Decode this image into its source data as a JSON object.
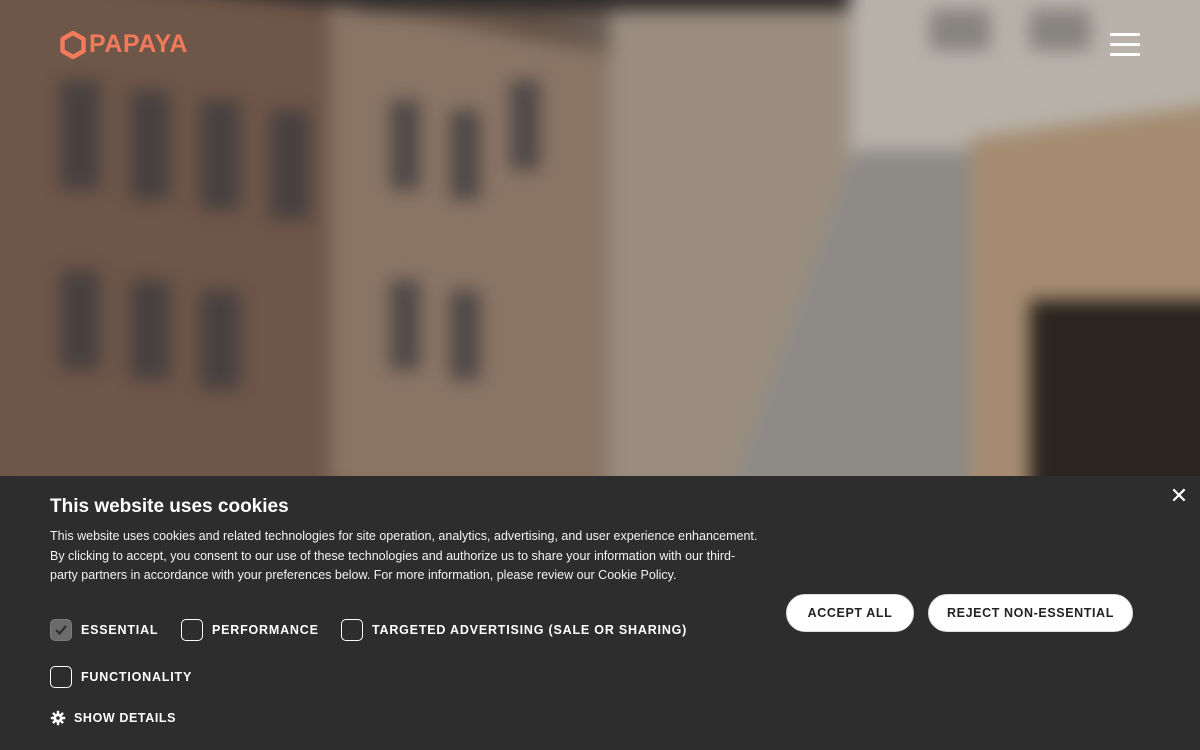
{
  "header": {
    "logo_text": "PAPAYA",
    "logo_color": "#f07a5a",
    "menu_icon": "hamburger-menu-icon"
  },
  "cookie_banner": {
    "title": "This website uses cookies",
    "body": "This website uses cookies and related technologies for site operation, analytics, advertising, and user experience enhancement. By clicking to accept, you consent to our use of these technologies and authorize us to share your information with our third-party partners in accordance with your preferences below. For more information, please review our Cookie Policy.",
    "close_icon": "close-icon",
    "options": [
      {
        "label": "ESSENTIAL",
        "checked": true
      },
      {
        "label": "PERFORMANCE",
        "checked": false
      },
      {
        "label": "TARGETED ADVERTISING (SALE OR SHARING)",
        "checked": false
      },
      {
        "label": "FUNCTIONALITY",
        "checked": false
      }
    ],
    "show_details_label": "SHOW DETAILS",
    "show_details_icon": "gear-icon",
    "accept_label": "ACCEPT ALL",
    "reject_label": "REJECT NON-ESSENTIAL",
    "background_color": "#2d2d2d"
  }
}
